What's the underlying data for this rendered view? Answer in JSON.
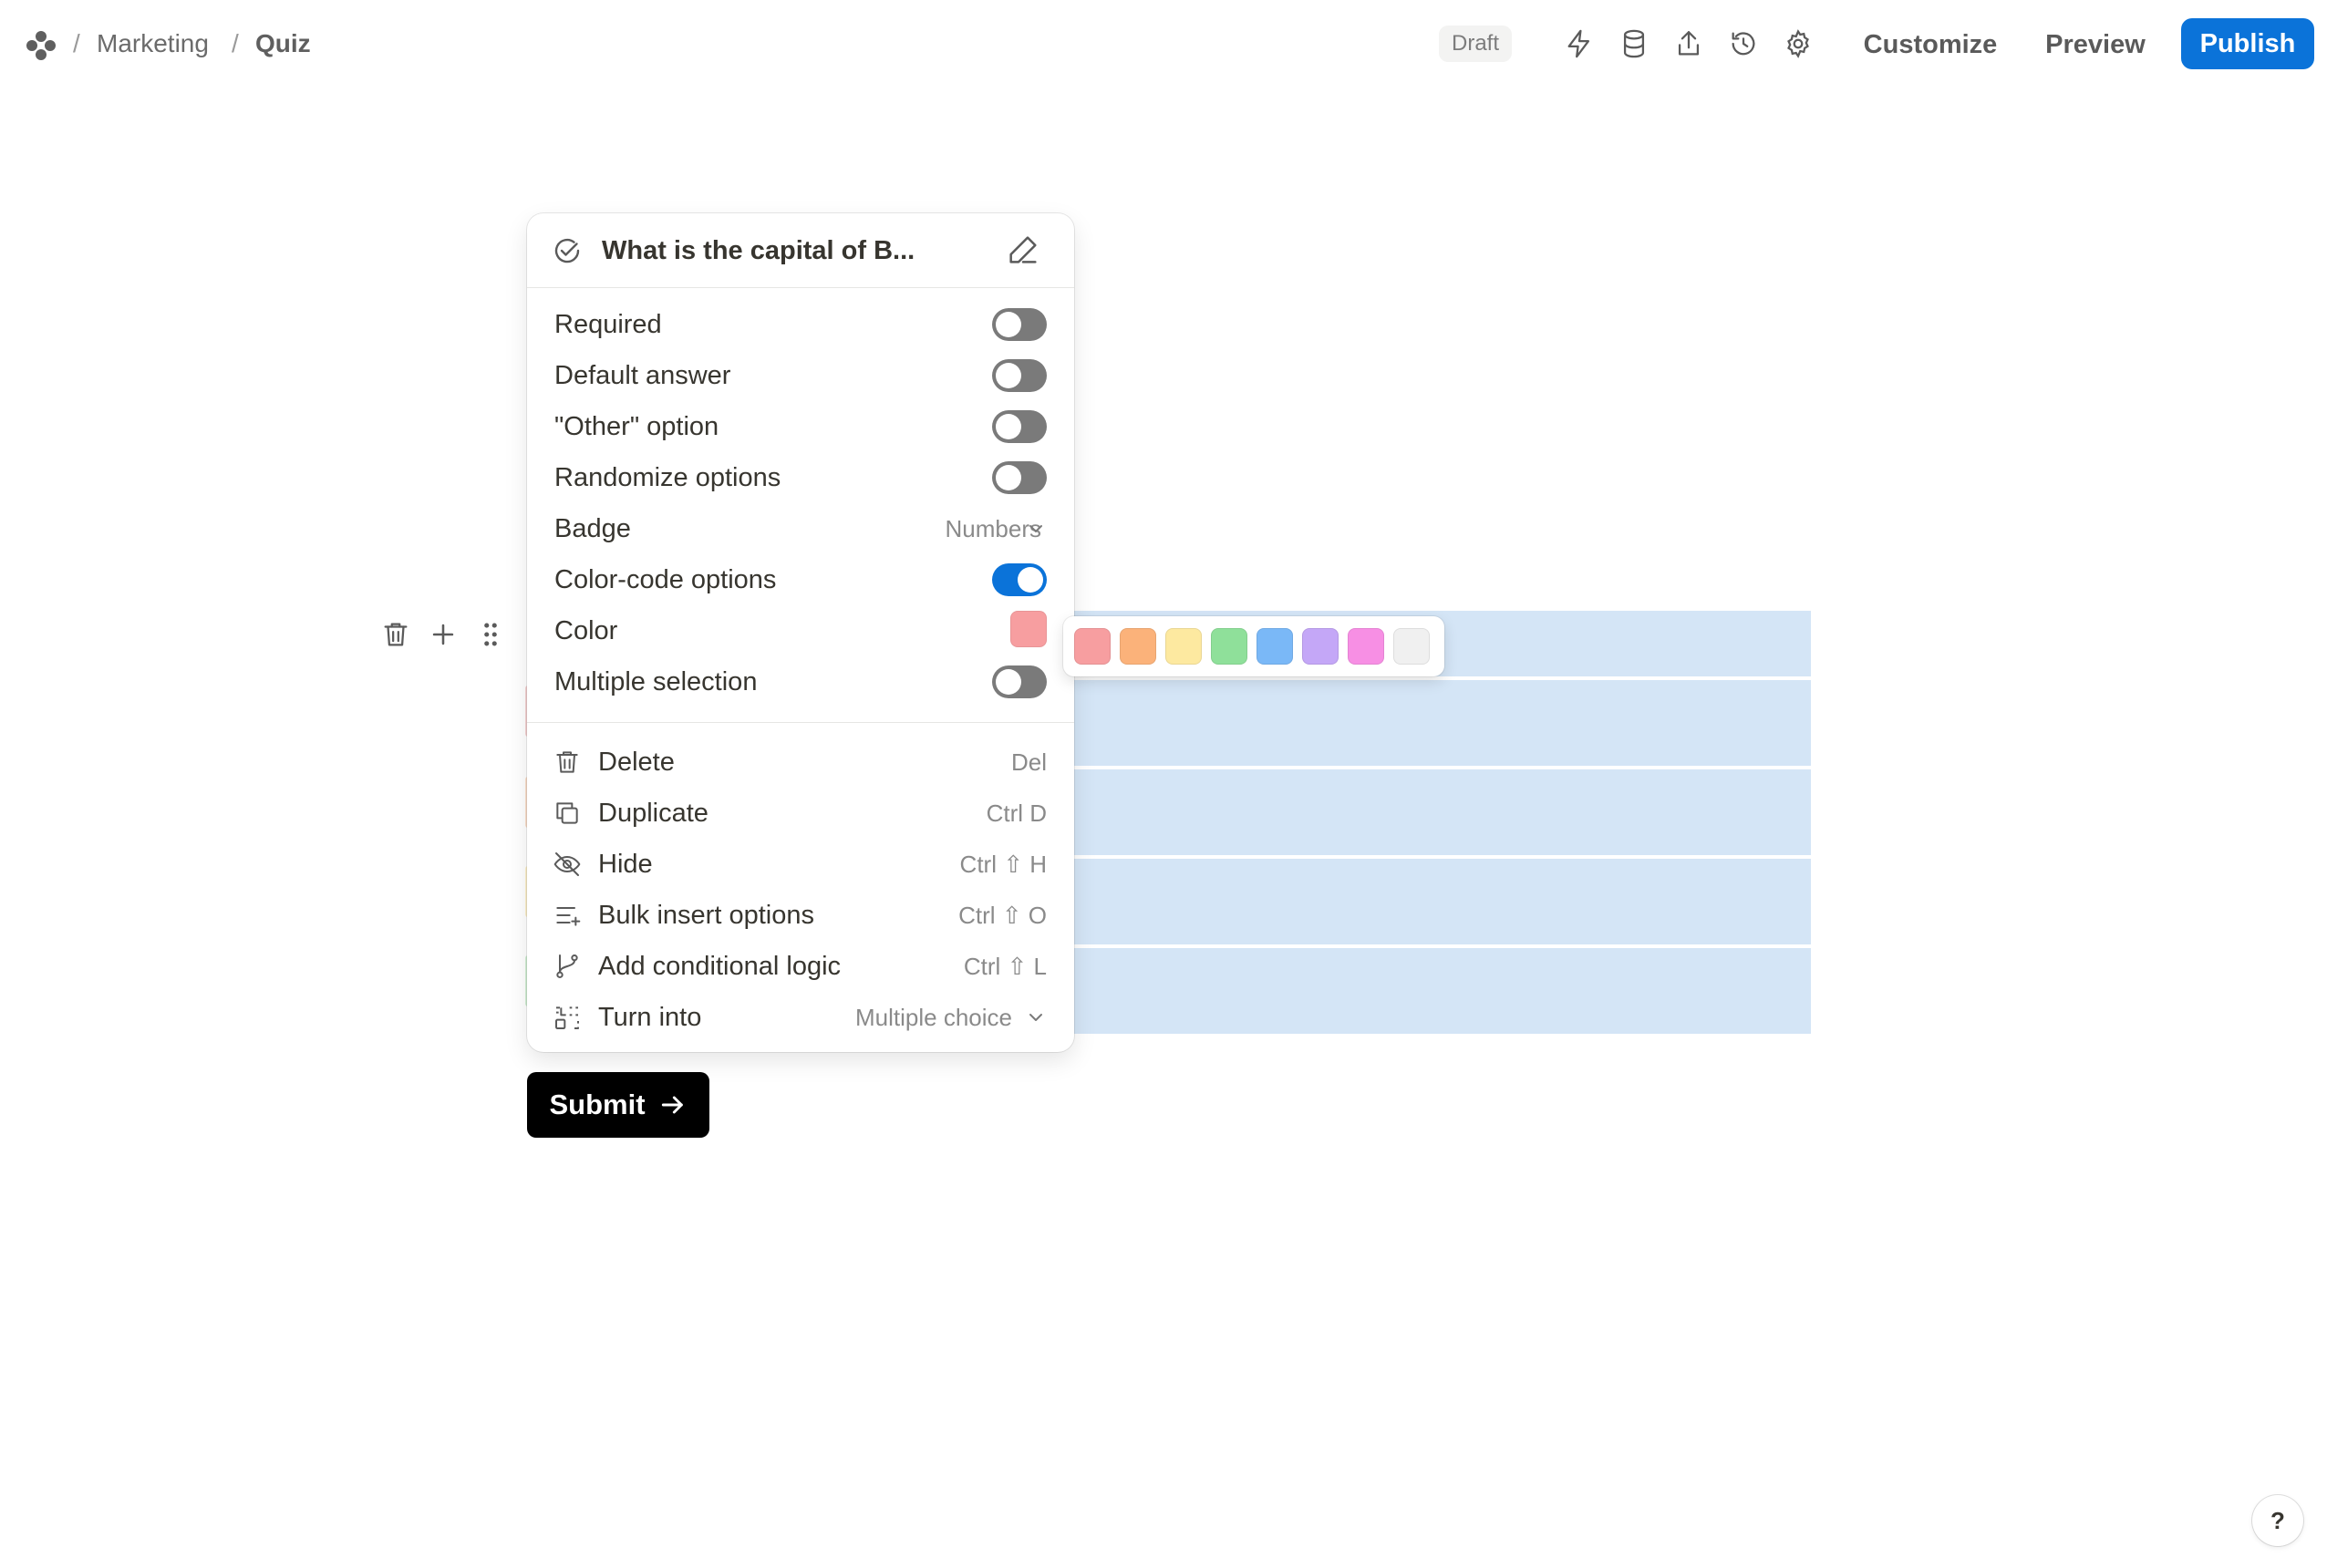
{
  "breadcrumb": {
    "sep1": "/",
    "workspace": "Marketing",
    "sep2": "/",
    "page": "Quiz"
  },
  "header": {
    "status_badge": "Draft",
    "icons": [
      "lightning-icon",
      "database-icon",
      "share-upload-icon",
      "history-icon",
      "settings-gear-icon"
    ],
    "customize_label": "Customize",
    "preview_label": "Preview",
    "publish_label": "Publish"
  },
  "menu": {
    "question_title": "What is the capital of B...",
    "settings": [
      {
        "label": "Required",
        "type": "toggle",
        "on": false
      },
      {
        "label": "Default answer",
        "type": "toggle",
        "on": false
      },
      {
        "label": "\"Other\" option",
        "type": "toggle",
        "on": false
      },
      {
        "label": "Randomize options",
        "type": "toggle",
        "on": false
      },
      {
        "label": "Badge",
        "type": "select",
        "value": "Numbers"
      },
      {
        "label": "Color-code options",
        "type": "toggle",
        "on": true
      },
      {
        "label": "Color",
        "type": "color",
        "value": "#f79ea0"
      },
      {
        "label": "Multiple selection",
        "type": "toggle",
        "on": false
      }
    ],
    "actions": [
      {
        "label": "Delete",
        "shortcut": "Del",
        "icon": "trash-icon"
      },
      {
        "label": "Duplicate",
        "shortcut": "Ctrl D",
        "icon": "duplicate-icon"
      },
      {
        "label": "Hide",
        "shortcut": "Ctrl ⇧ H",
        "icon": "eye-off-icon"
      },
      {
        "label": "Bulk insert options",
        "shortcut": "Ctrl ⇧ O",
        "icon": "list-plus-icon"
      },
      {
        "label": "Add conditional logic",
        "shortcut": "Ctrl ⇧ L",
        "icon": "branch-icon"
      },
      {
        "label": "Turn into",
        "value": "Multiple choice",
        "icon": "transform-icon"
      }
    ]
  },
  "palette": {
    "colors": [
      "#f79ea0",
      "#fbb27a",
      "#fde9a0",
      "#8fe09a",
      "#7ab8f7",
      "#c4a7f7",
      "#f78fe4",
      "#f0f0f0"
    ]
  },
  "submit": {
    "label": "Submit"
  },
  "help": {
    "label": "?"
  }
}
